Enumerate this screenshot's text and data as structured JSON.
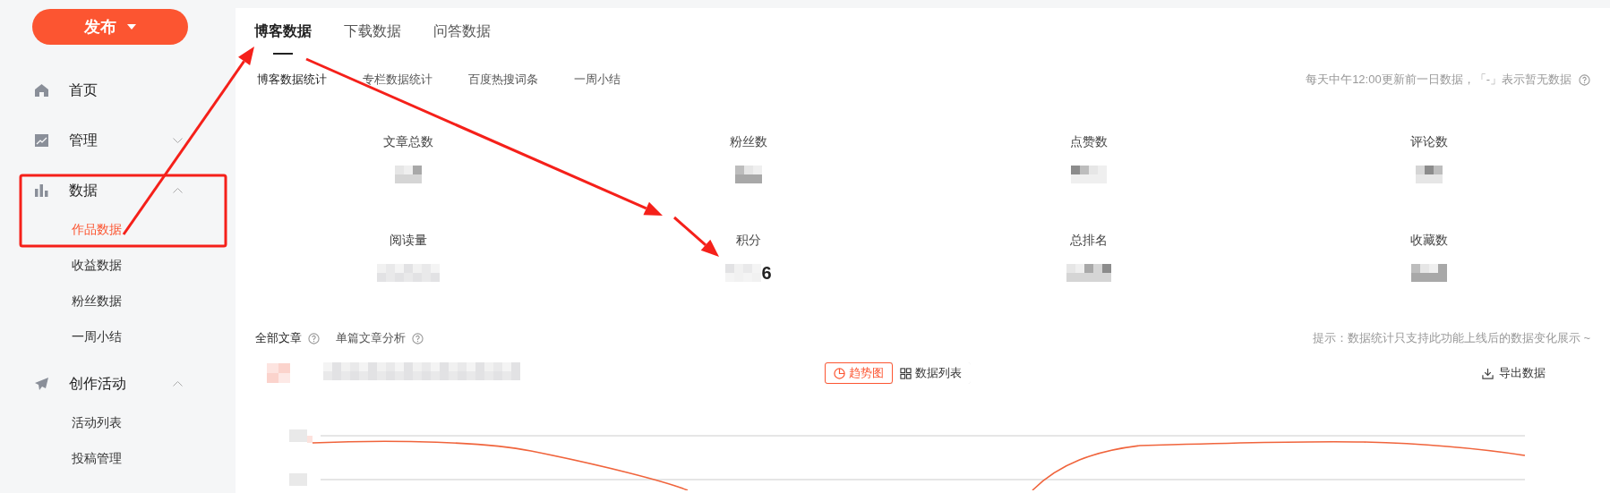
{
  "sidebar": {
    "publish_button": {
      "label": "发布"
    },
    "items": [
      {
        "label": "首页"
      },
      {
        "label": "管理",
        "expanded": false
      },
      {
        "label": "数据",
        "expanded": true,
        "children": [
          {
            "label": "作品数据",
            "selected": true
          },
          {
            "label": "收益数据",
            "selected": false
          },
          {
            "label": "粉丝数据",
            "selected": false
          },
          {
            "label": "一周小结",
            "selected": false
          }
        ]
      },
      {
        "label": "创作活动",
        "expanded": true,
        "children": [
          {
            "label": "活动列表",
            "selected": false
          },
          {
            "label": "投稿管理",
            "selected": false
          }
        ]
      }
    ]
  },
  "tabs": [
    {
      "label": "博客数据",
      "selected": true
    },
    {
      "label": "下载数据",
      "selected": false
    },
    {
      "label": "问答数据",
      "selected": false
    }
  ],
  "sub_tabs": [
    {
      "label": "博客数据统计",
      "selected": true
    },
    {
      "label": "专栏数据统计",
      "selected": false
    },
    {
      "label": "百度热搜词条",
      "selected": false
    },
    {
      "label": "一周小结",
      "selected": false
    }
  ],
  "update_note": "每天中午12:00更新前一日数据，「-」表示暂无数据",
  "stats": [
    {
      "label": "文章总数"
    },
    {
      "label": "粉丝数"
    },
    {
      "label": "点赞数"
    },
    {
      "label": "评论数"
    },
    {
      "label": "阅读量"
    },
    {
      "label": "积分",
      "value": "6"
    },
    {
      "label": "总排名"
    },
    {
      "label": "收藏数"
    }
  ],
  "article_tabs": [
    {
      "label": "全部文章",
      "selected": true
    },
    {
      "label": "单篇文章分析",
      "selected": false
    }
  ],
  "hint": "提示：数据统计只支持此功能上线后的数据变化展示 ~",
  "view_toggle": [
    {
      "label": "趋势图",
      "selected": true
    },
    {
      "label": "数据列表",
      "selected": false
    }
  ],
  "export_button": {
    "label": "导出数据"
  }
}
